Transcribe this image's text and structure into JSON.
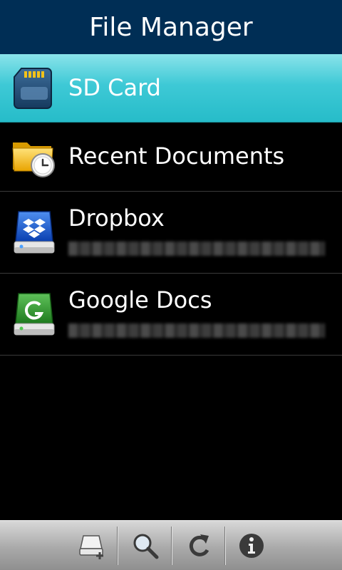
{
  "header": {
    "title": "File Manager"
  },
  "list": {
    "items": [
      {
        "label": "SD Card"
      },
      {
        "label": "Recent Documents"
      },
      {
        "label": "Dropbox"
      },
      {
        "label": "Google Docs"
      }
    ]
  },
  "icons": {
    "sd_card": "sd-card-icon",
    "recent": "folder-clock-icon",
    "dropbox": "dropbox-drive-icon",
    "google_docs": "google-docs-drive-icon",
    "add_drive": "add-drive-icon",
    "search": "search-icon",
    "refresh": "refresh-icon",
    "info": "info-icon"
  },
  "colors": {
    "header_bg": "#002e55",
    "selected_row": "#3ec9d6",
    "toolbar": "#a9a9a9"
  }
}
